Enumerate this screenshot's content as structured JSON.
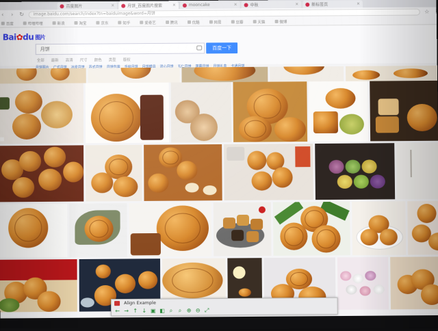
{
  "browser": {
    "tabs": [
      {
        "label": "百度图片",
        "active": false
      },
      {
        "label": "月饼_百度图片搜索",
        "active": true
      },
      {
        "label": "mooncake",
        "active": false
      },
      {
        "label": "中秋",
        "active": false
      },
      {
        "label": "新标签页",
        "active": false
      }
    ],
    "url": "image.baidu.com/search/index?tn=baiduimage&word=月饼",
    "bookmarks": [
      "百度",
      "哔哩哔哩",
      "新浪",
      "淘宝",
      "京东",
      "知乎",
      "爱奇艺",
      "腾讯",
      "优酷",
      "网易",
      "豆瓣",
      "天猫",
      "微博"
    ]
  },
  "search": {
    "logo": "Bai",
    "logo_paw": "du",
    "logo_suffix": "图片",
    "query": "月饼",
    "button_label": "百度一下",
    "filters": [
      "全部",
      "最新",
      "高清",
      "尺寸",
      "颜色",
      "类型",
      "版权"
    ],
    "suggestions": [
      "月饼图片",
      "广式月饼",
      "冰皮月饼",
      "苏式月饼",
      "月饼包装",
      "手绘月饼",
      "月饼模具",
      "流心月饼",
      "五仁月饼",
      "莲蓉月饼",
      "月饼礼盒",
      "卡通月饼"
    ]
  },
  "viewer": {
    "title": "Align Example",
    "tools": [
      "←",
      "→",
      "↑",
      "↓",
      "▣",
      "◧",
      "⌕",
      "⌕",
      "⊕",
      "⊖",
      "⤢"
    ]
  },
  "colors": {
    "accent": "#3385ff",
    "logo_blue": "#2932e1",
    "logo_red": "#e10601"
  }
}
